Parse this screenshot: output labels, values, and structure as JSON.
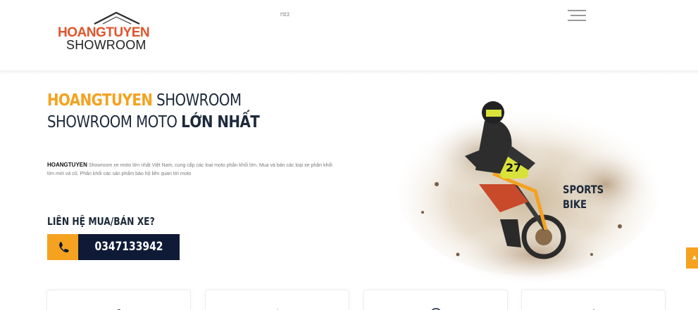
{
  "header": {
    "logo_top": "HOANGTUYEN",
    "logo_bottom": "SHOWROOM",
    "small_text": "ΠΣΣ",
    "menu_icon": "hamburger-icon"
  },
  "hero": {
    "title_brand": "HOANGTUYEN",
    "title_rest": " SHOWROOM",
    "title_line2_regular": "SHOWROOM MOTO ",
    "title_line2_bold": "LỚN NHẤT",
    "desc_brand": "HOANGTUYEN",
    "desc_text": " Showroom xe moto lớn nhất Việt Nam, cung cấp các loại moto phân khối lớn. Mua và bán các loại xe phân khối lớn mới và cũ. Phân khối các sản phẩm bảo hộ liên quan tới moto",
    "contact_label": "LIÊN HỆ MUA/BÁN XE?",
    "phone": "0347133942",
    "phone_icon": "phone-icon"
  },
  "image": {
    "caption_line1": "SPORTS",
    "caption_line2": "BIKE"
  },
  "cards": [
    {
      "icon": "helmet-icon"
    },
    {
      "icon": "wrench-icon"
    },
    {
      "icon": "circle-icon"
    },
    {
      "icon": "tag-icon"
    }
  ],
  "colors": {
    "accent": "#f4a21f",
    "navy": "#0f1a36",
    "logo_red": "#e0542b"
  }
}
